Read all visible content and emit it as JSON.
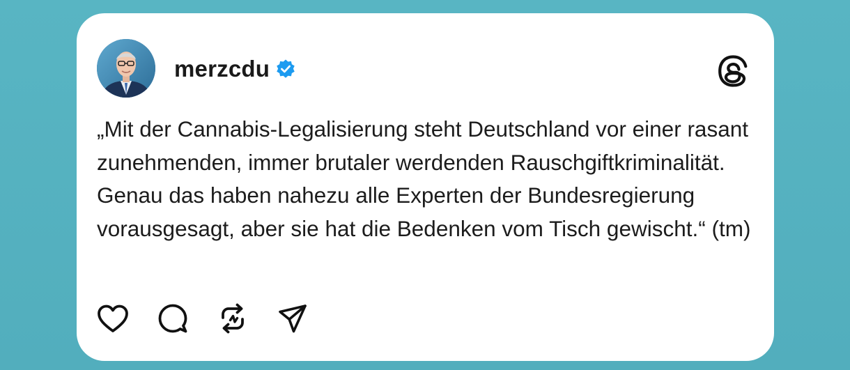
{
  "post": {
    "username": "merzcdu",
    "verified": true,
    "text": "„Mit der Cannabis-Legalisierung steht Deutschland vor einer rasant zunehmenden, immer brutaler werdenden Rauschgiftkriminalität. Genau das haben nahezu alle Experten der Bundesregierung vorausgesagt, aber sie hat die Bedenken vom Tisch gewischt.“ (tm)"
  },
  "icons": {
    "brand": "threads-logo-icon",
    "verified": "verified-badge-icon",
    "actions": [
      "heart-icon",
      "comment-icon",
      "repost-icon",
      "share-icon"
    ]
  },
  "colors": {
    "background": "#56b2c0",
    "card": "#ffffff",
    "text": "#1c1c1c",
    "verified_badge": "#1d9bf0"
  }
}
